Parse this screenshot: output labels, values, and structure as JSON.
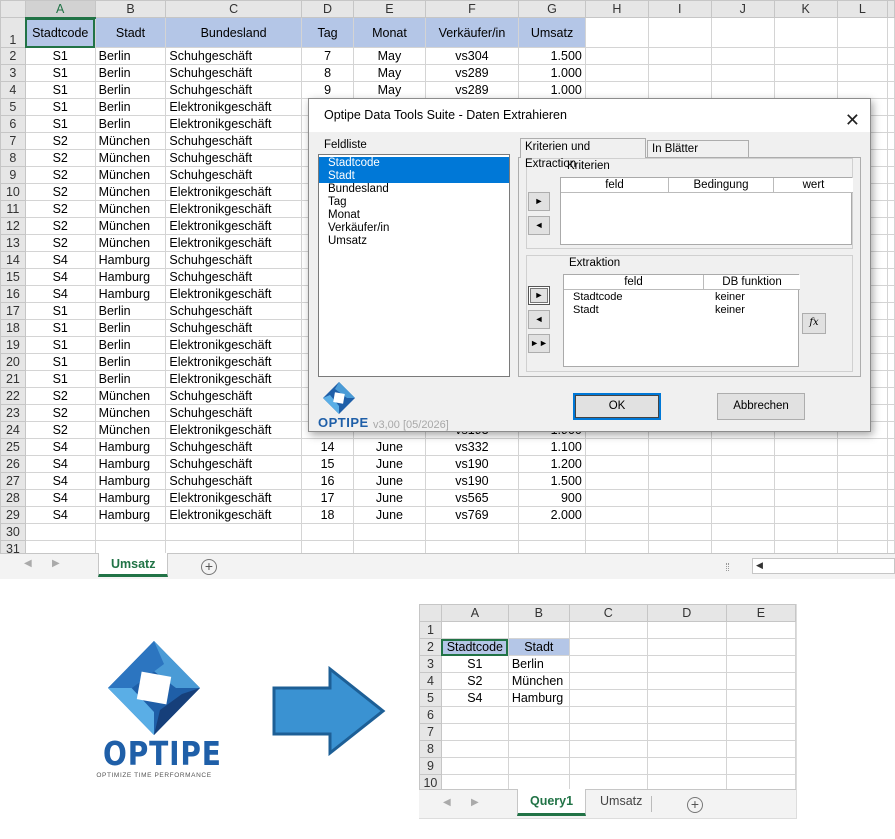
{
  "sheet": {
    "columns": [
      "A",
      "B",
      "C",
      "D",
      "E",
      "F",
      "G",
      "H",
      "I",
      "J",
      "K",
      "L"
    ],
    "header_row": [
      "Stadtcode",
      "Stadt",
      "Bundesland",
      "Tag",
      "Monat",
      "Verkäufer/in",
      "Umsatz"
    ],
    "rows": [
      [
        "S1",
        "Berlin",
        "Schuhgeschäft",
        "7",
        "May",
        "vs304",
        "1.500"
      ],
      [
        "S1",
        "Berlin",
        "Schuhgeschäft",
        "8",
        "May",
        "vs289",
        "1.000"
      ],
      [
        "S1",
        "Berlin",
        "Schuhgeschäft",
        "9",
        "May",
        "vs289",
        "1.000"
      ],
      [
        "S1",
        "Berlin",
        "Elektronikgeschäft",
        "",
        "",
        "",
        ""
      ],
      [
        "S1",
        "Berlin",
        "Elektronikgeschäft",
        "",
        "",
        "",
        ""
      ],
      [
        "S2",
        "München",
        "Schuhgeschäft",
        "",
        "",
        "",
        ""
      ],
      [
        "S2",
        "München",
        "Schuhgeschäft",
        "",
        "",
        "",
        ""
      ],
      [
        "S2",
        "München",
        "Schuhgeschäft",
        "",
        "",
        "",
        ""
      ],
      [
        "S2",
        "München",
        "Elektronikgeschäft",
        "",
        "",
        "",
        ""
      ],
      [
        "S2",
        "München",
        "Elektronikgeschäft",
        "",
        "",
        "",
        ""
      ],
      [
        "S2",
        "München",
        "Elektronikgeschäft",
        "",
        "",
        "",
        ""
      ],
      [
        "S2",
        "München",
        "Elektronikgeschäft",
        "",
        "",
        "",
        ""
      ],
      [
        "S4",
        "Hamburg",
        "Schuhgeschäft",
        "",
        "",
        "",
        ""
      ],
      [
        "S4",
        "Hamburg",
        "Schuhgeschäft",
        "",
        "",
        "",
        ""
      ],
      [
        "S4",
        "Hamburg",
        "Elektronikgeschäft",
        "",
        "",
        "",
        ""
      ],
      [
        "S1",
        "Berlin",
        "Schuhgeschäft",
        "",
        "",
        "",
        ""
      ],
      [
        "S1",
        "Berlin",
        "Schuhgeschäft",
        "",
        "",
        "",
        ""
      ],
      [
        "S1",
        "Berlin",
        "Elektronikgeschäft",
        "",
        "",
        "",
        ""
      ],
      [
        "S1",
        "Berlin",
        "Elektronikgeschäft",
        "",
        "",
        "",
        ""
      ],
      [
        "S1",
        "Berlin",
        "Elektronikgeschäft",
        "",
        "",
        "",
        ""
      ],
      [
        "S2",
        "München",
        "Schuhgeschäft",
        "",
        "",
        "",
        ""
      ],
      [
        "S2",
        "München",
        "Schuhgeschäft",
        "",
        "",
        "",
        ""
      ],
      [
        "S2",
        "München",
        "Elektronikgeschäft",
        "",
        "",
        "vs193",
        "1.900"
      ],
      [
        "S4",
        "Hamburg",
        "Schuhgeschäft",
        "14",
        "June",
        "vs332",
        "1.100"
      ],
      [
        "S4",
        "Hamburg",
        "Schuhgeschäft",
        "15",
        "June",
        "vs190",
        "1.200"
      ],
      [
        "S4",
        "Hamburg",
        "Schuhgeschäft",
        "16",
        "June",
        "vs190",
        "1.500"
      ],
      [
        "S4",
        "Hamburg",
        "Elektronikgeschäft",
        "17",
        "June",
        "vs565",
        "900"
      ],
      [
        "S4",
        "Hamburg",
        "Elektronikgeschäft",
        "18",
        "June",
        "vs769",
        "2.000"
      ]
    ],
    "row_numbers": [
      "1",
      "2",
      "3",
      "4",
      "5",
      "6",
      "7",
      "8",
      "9",
      "10",
      "11",
      "12",
      "13",
      "14",
      "15",
      "16",
      "17",
      "18",
      "19",
      "20",
      "21",
      "22",
      "23",
      "24",
      "25",
      "26",
      "27",
      "28",
      "29",
      "30",
      "31"
    ],
    "tab": "Umsatz",
    "add_sheet": "+"
  },
  "dialog": {
    "title": "Optipe Data Tools Suite - Daten Extrahieren",
    "close": "✕",
    "field_list_label": "Feldliste",
    "fields": [
      "Stadtcode",
      "Stadt",
      "Bundesland",
      "Tag",
      "Monat",
      "Verkäufer/in",
      "Umsatz"
    ],
    "tabs": [
      "Kriterien und Extraction",
      "In Blätter aufteilen"
    ],
    "criteria_label": "Kriterien",
    "criteria_columns": [
      "feld",
      "Bedingung",
      "wert"
    ],
    "extraction_label": "Extraktion",
    "extraction_columns": [
      "feld",
      "DB funktion"
    ],
    "extraction_rows": [
      [
        "Stadtcode",
        "keiner"
      ],
      [
        "Stadt",
        "keiner"
      ]
    ],
    "ok": "OK",
    "cancel": "Abbrechen",
    "fx": "fx",
    "brand": "OPTIPE",
    "version": "v3,00 [05/2026]",
    "btn_right": "►",
    "btn_left": "◄",
    "btn_all": "►►"
  },
  "logo": {
    "brand": "OPTIPE",
    "tagline": "OPTIMIZE TIME PERFORMANCE",
    "primary_color": "#1f5fa8",
    "secondary_color": "#4a9bd6"
  },
  "arrow_color": "#3a92d2",
  "result_sheet": {
    "columns": [
      "A",
      "B",
      "C",
      "D",
      "E"
    ],
    "rows": [
      [
        "",
        ""
      ],
      [
        "Stadtcode",
        "Stadt"
      ],
      [
        "S1",
        "Berlin"
      ],
      [
        "S2",
        "München"
      ],
      [
        "S4",
        "Hamburg"
      ],
      [
        "",
        ""
      ],
      [
        "",
        ""
      ],
      [
        "",
        ""
      ],
      [
        "",
        ""
      ],
      [
        "",
        ""
      ]
    ],
    "row_numbers": [
      "1",
      "2",
      "3",
      "4",
      "5",
      "6",
      "7",
      "8",
      "9",
      "10"
    ],
    "tabs": [
      "Query1",
      "Umsatz"
    ],
    "add_sheet": "+"
  }
}
